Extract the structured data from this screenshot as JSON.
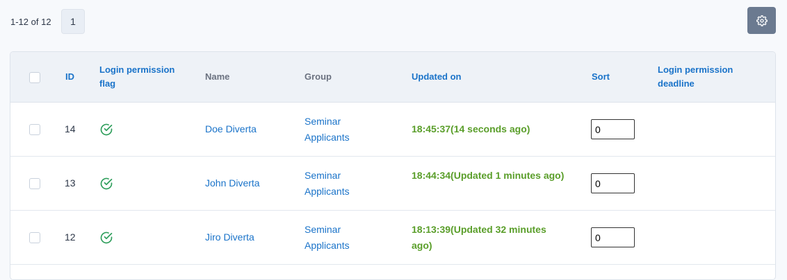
{
  "pagination": {
    "range_text": "1-12 of 12",
    "current_page": "1"
  },
  "toolbar": {
    "settings_icon": "gear-icon"
  },
  "table": {
    "headers": {
      "id": "ID",
      "login_flag": "Login permission flag",
      "name": "Name",
      "group": "Group",
      "updated_on": "Updated on",
      "sort": "Sort",
      "deadline": "Login permission deadline"
    },
    "rows": [
      {
        "id": "14",
        "login_flag": "check-circle-icon",
        "name": "Doe Diverta",
        "group": "Seminar Applicants",
        "updated_on": "18:45:37(14 seconds ago)",
        "sort": "0",
        "deadline": ""
      },
      {
        "id": "13",
        "login_flag": "check-circle-icon",
        "name": "John Diverta",
        "group": "Seminar Applicants",
        "updated_on": "18:44:34(Updated 1 minutes ago)",
        "sort": "0",
        "deadline": ""
      },
      {
        "id": "12",
        "login_flag": "check-circle-icon",
        "name": "Jiro Diverta",
        "group": "Seminar Applicants",
        "updated_on": "18:13:39(Updated 32 minutes ago)",
        "sort": "0",
        "deadline": ""
      }
    ]
  },
  "colors": {
    "link": "#1a73c9",
    "updated": "#5a9e2a",
    "check": "#2e9e5b"
  }
}
